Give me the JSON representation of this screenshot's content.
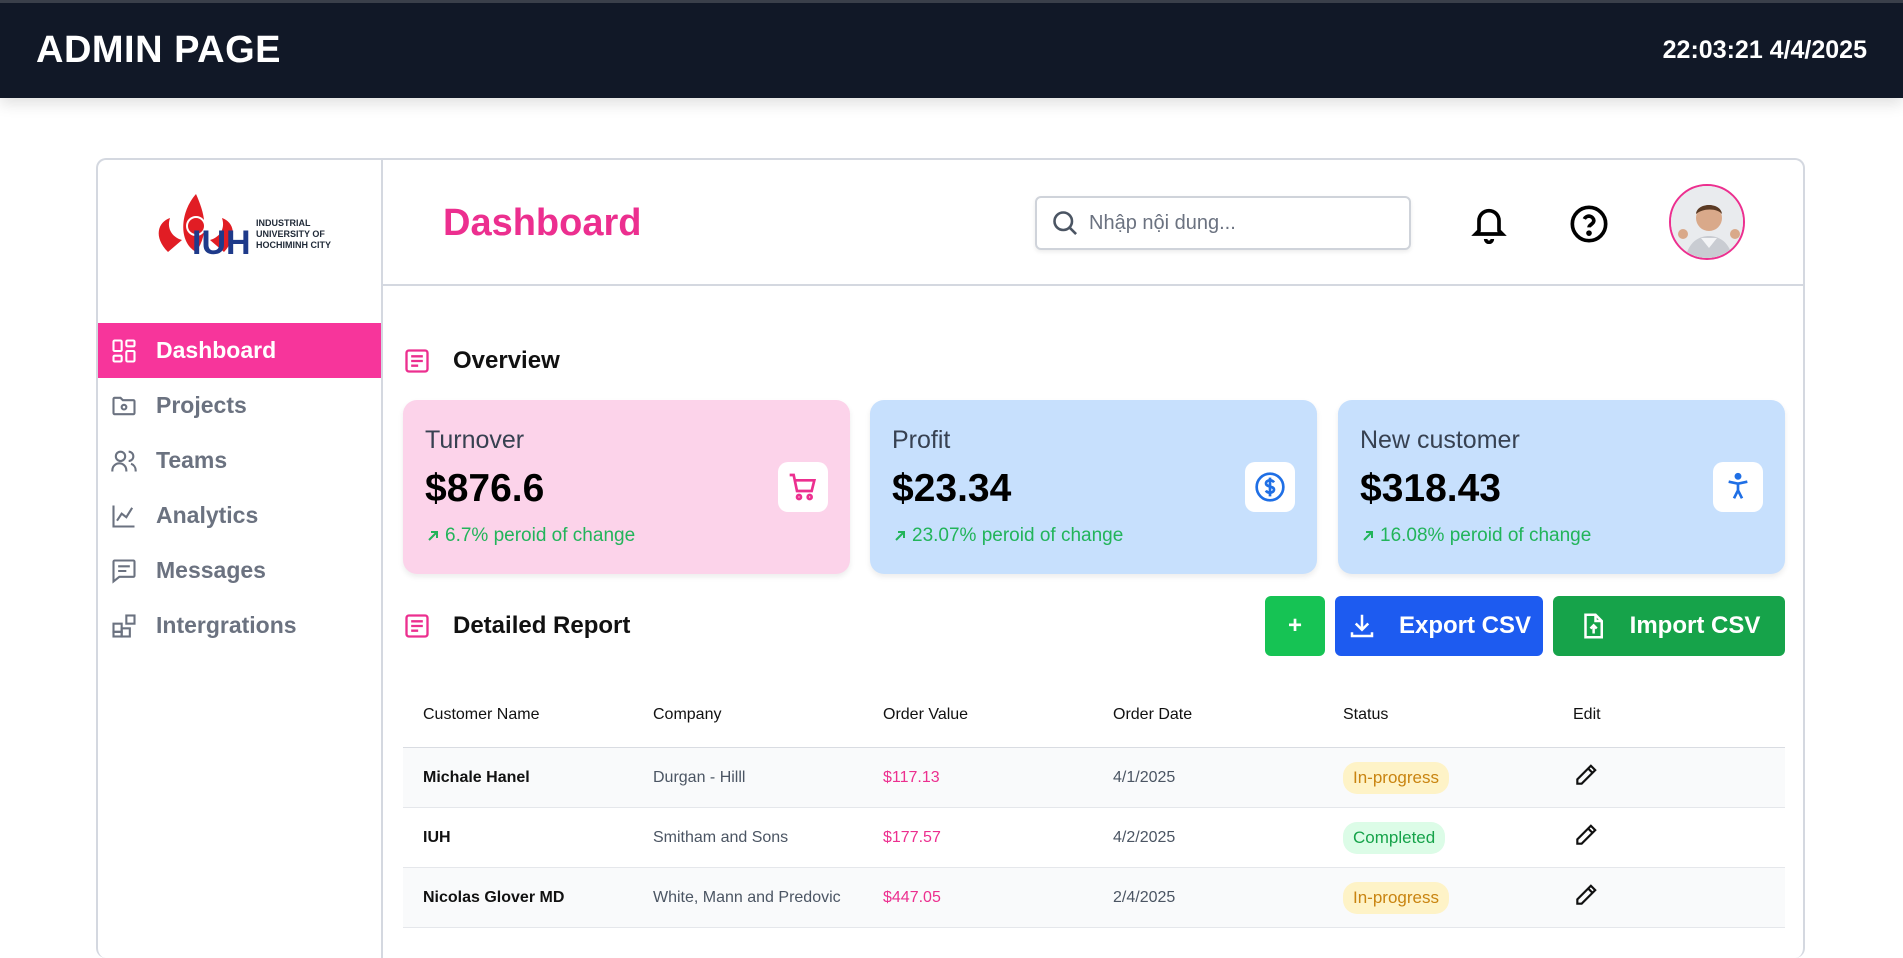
{
  "topbar": {
    "title": "ADMIN PAGE",
    "clock": "22:03:21 4/4/2025"
  },
  "logo": {
    "line1": "INDUSTRIAL",
    "line2": "UNIVERSITY OF",
    "line3": "HOCHIMINH CITY",
    "mark": "IUH"
  },
  "sidebar": {
    "items": [
      {
        "label": "Dashboard",
        "icon": "grid-icon",
        "active": true
      },
      {
        "label": "Projects",
        "icon": "folder-icon"
      },
      {
        "label": "Teams",
        "icon": "users-icon"
      },
      {
        "label": "Analytics",
        "icon": "chart-line-icon"
      },
      {
        "label": "Messages",
        "icon": "message-icon"
      },
      {
        "label": "Intergrations",
        "icon": "puzzle-icon"
      }
    ]
  },
  "header": {
    "title": "Dashboard",
    "search_placeholder": "Nhập nội dung..."
  },
  "overview": {
    "label": "Overview",
    "cards": [
      {
        "title": "Turnover",
        "value": "$876.6",
        "change": "6.7% peroid of change",
        "icon": "cart-icon",
        "bg": "#fcd3ea",
        "accent": "#ec2f8f"
      },
      {
        "title": "Profit",
        "value": "$23.34",
        "change": "23.07% peroid of change",
        "icon": "dollar-circle-icon",
        "bg": "#c7e0fd",
        "accent": "#1f6fe5"
      },
      {
        "title": "New customer",
        "value": "$318.43",
        "change": "16.08% peroid of change",
        "icon": "accessibility-icon",
        "bg": "#c7e0fd",
        "accent": "#1f6fe5"
      }
    ]
  },
  "report": {
    "label": "Detailed Report",
    "add_label": "+",
    "export_label": "Export CSV",
    "import_label": "Import CSV",
    "columns": [
      "Customer Name",
      "Company",
      "Order Value",
      "Order Date",
      "Status",
      "Edit"
    ],
    "rows": [
      {
        "name": "Michale Hanel",
        "company": "Durgan - Hilll",
        "value": "$117.13",
        "date": "4/1/2025",
        "status": "In-progress"
      },
      {
        "name": "IUH",
        "company": "Smitham and Sons",
        "value": "$177.57",
        "date": "4/2/2025",
        "status": "Completed"
      },
      {
        "name": "Nicolas Glover MD",
        "company": "White, Mann and Predovic",
        "value": "$447.05",
        "date": "2/4/2025",
        "status": "In-progress"
      }
    ]
  },
  "colors": {
    "brand": "#ec2f8f",
    "nav_active": "#f7359b",
    "topbar": "#111827",
    "export": "#1d5bf0",
    "import": "#16a34a",
    "add": "#16c354"
  }
}
